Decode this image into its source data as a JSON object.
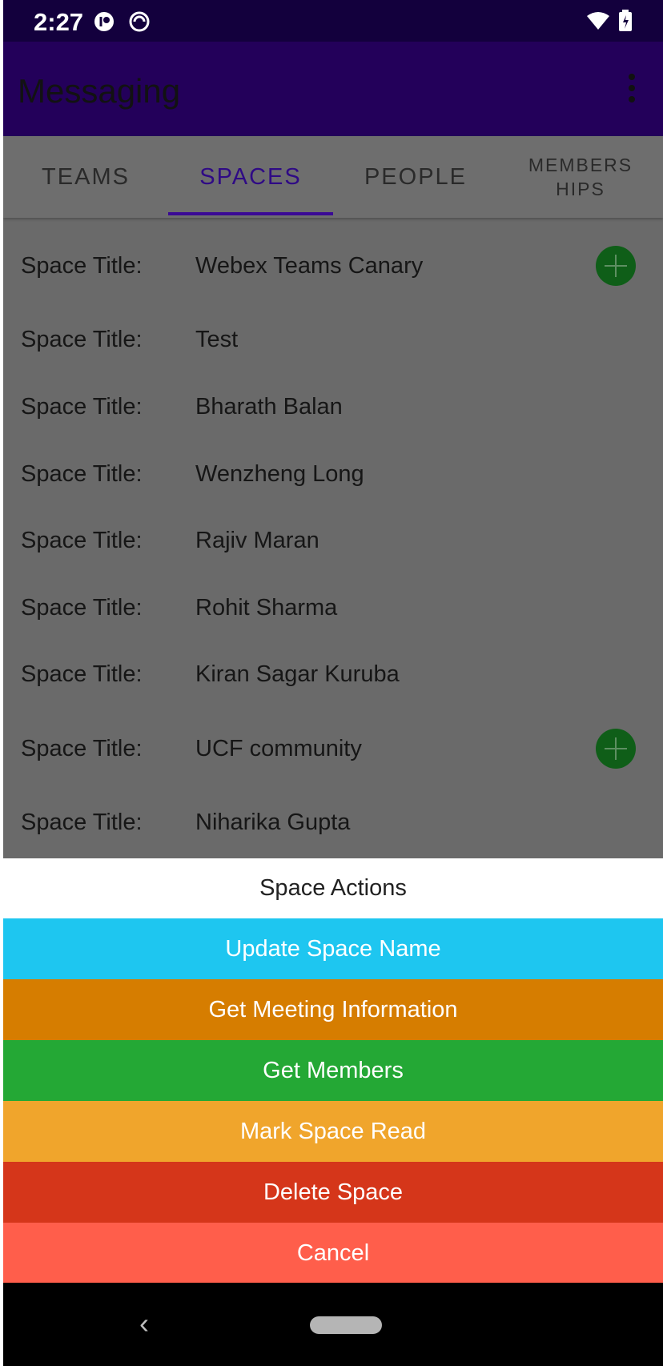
{
  "status_bar": {
    "time": "2:27"
  },
  "app_bar": {
    "title": "Messaging"
  },
  "tabs": [
    {
      "label": "TEAMS",
      "active": false
    },
    {
      "label": "SPACES",
      "active": true
    },
    {
      "label": "PEOPLE",
      "active": false
    },
    {
      "label": "MEMBERS\nHIPS",
      "active": false
    }
  ],
  "spaces": [
    {
      "label": "Space Title:",
      "value": "Webex Teams Canary",
      "has_add_button": true
    },
    {
      "label": "Space Title:",
      "value": "Test",
      "has_add_button": false
    },
    {
      "label": "Space Title:",
      "value": "Bharath Balan",
      "has_add_button": false
    },
    {
      "label": "Space Title:",
      "value": "Wenzheng Long",
      "has_add_button": false
    },
    {
      "label": "Space Title:",
      "value": "Rajiv Maran",
      "has_add_button": false
    },
    {
      "label": "Space Title:",
      "value": "Rohit Sharma",
      "has_add_button": false
    },
    {
      "label": "Space Title:",
      "value": "Kiran Sagar Kuruba",
      "has_add_button": false
    },
    {
      "label": "Space Title:",
      "value": "UCF community",
      "has_add_button": true
    },
    {
      "label": "Space Title:",
      "value": "Niharika Gupta",
      "has_add_button": false
    }
  ],
  "action_sheet": {
    "title": "Space Actions",
    "actions": [
      {
        "label": "Update Space Name",
        "color": "#1ec6f0"
      },
      {
        "label": "Get Meeting Information",
        "color": "#d67d00"
      },
      {
        "label": "Get Members",
        "color": "#24a835"
      },
      {
        "label": "Mark Space Read",
        "color": "#f0a52c"
      },
      {
        "label": "Delete Space",
        "color": "#d5361a"
      },
      {
        "label": "Cancel",
        "color": "#ff5e4b"
      }
    ]
  },
  "icons": {
    "status_left": [
      "app-notification-icon",
      "sync-icon"
    ],
    "status_right": [
      "wifi-icon",
      "battery-icon"
    ],
    "nav": [
      "back-icon",
      "home-pill-icon"
    ]
  }
}
